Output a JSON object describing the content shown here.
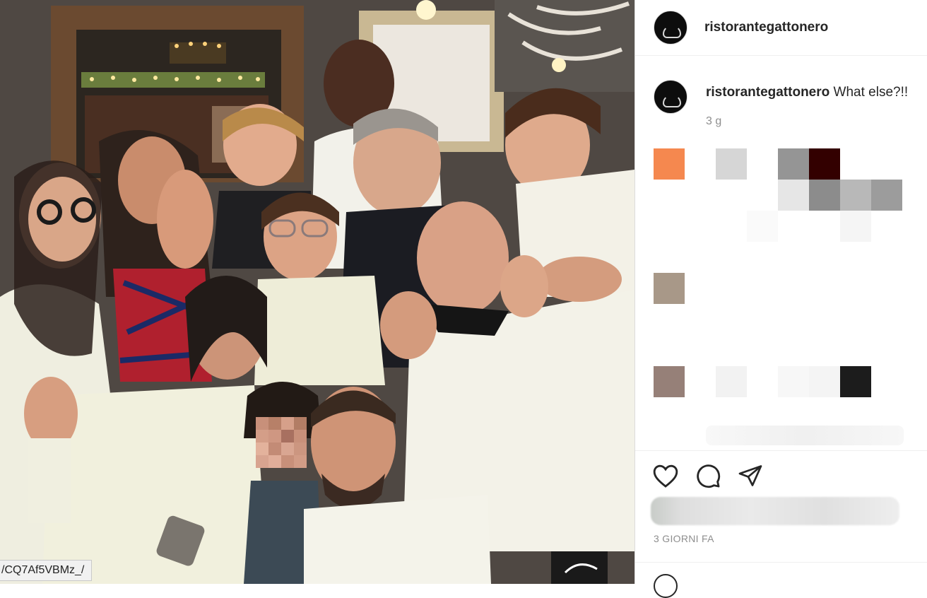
{
  "photo": {
    "url_tooltip": "/CQ7Af5VBMz_/"
  },
  "post": {
    "username": "ristorantegattonero",
    "caption_username": "ristorantegattonero",
    "caption_text": "What else?!!",
    "age": "3 g",
    "date": "3 GIORNI FA"
  },
  "comments_pixel_colors": [
    "#f5884f",
    "#d6d6d6",
    "#959595",
    "#330000",
    "#e6e6e6",
    "#8c8c8c",
    "#b8b8b8",
    "#9c9c9c",
    "#fafafa",
    "#f5f5f5",
    "#a89888",
    "#968078",
    "#f2f2f2",
    "#f7f7f7",
    "#f4f4f4",
    "#1c1c1c"
  ],
  "actions": {
    "like_icon": "heart-icon",
    "comment_icon": "comment-icon",
    "share_icon": "paper-plane-icon"
  }
}
